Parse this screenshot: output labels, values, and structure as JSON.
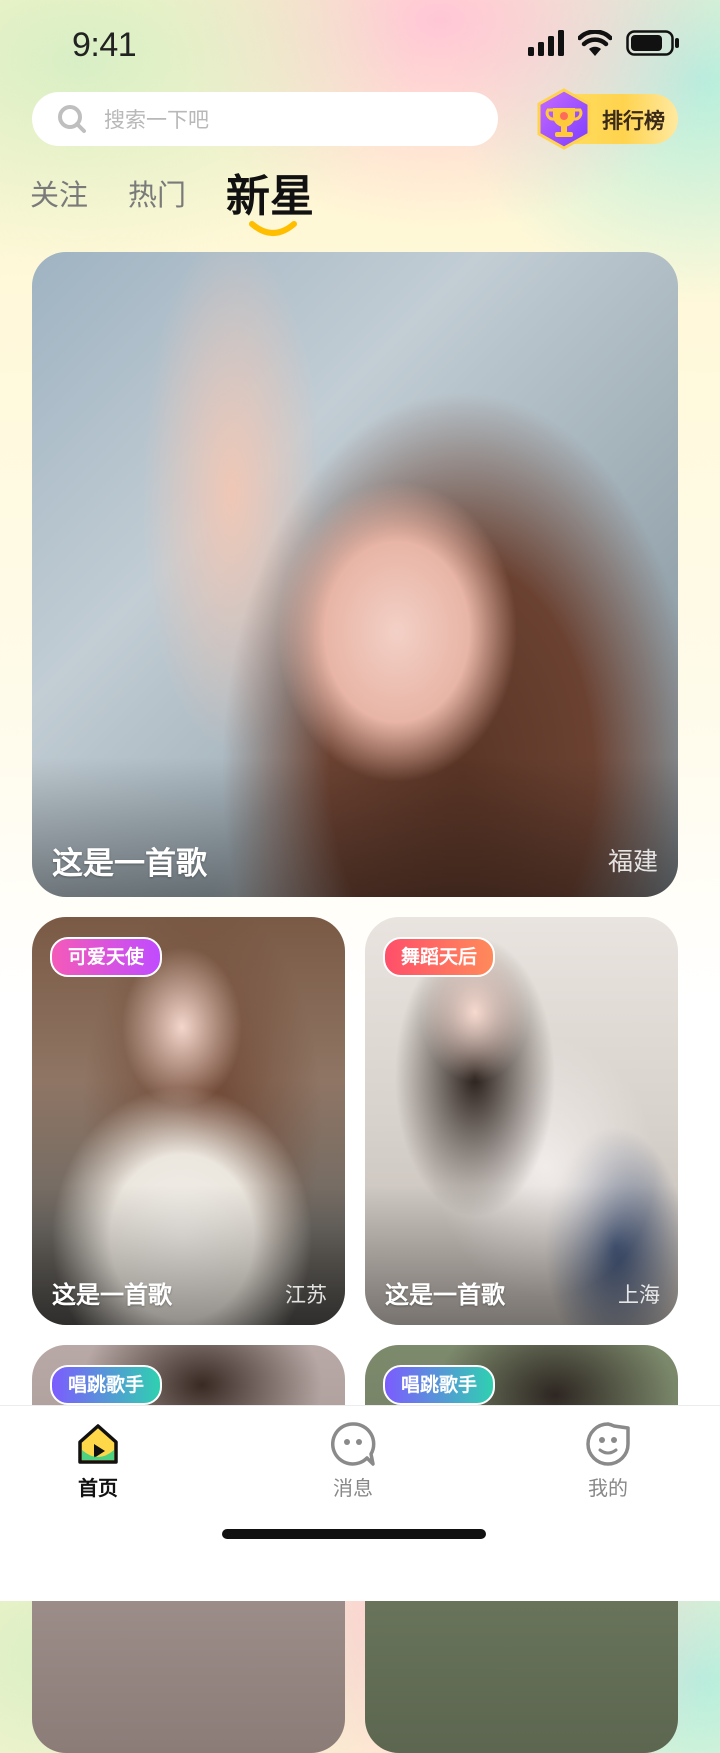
{
  "status_bar": {
    "time": "9:41",
    "icons": [
      "signal-icon",
      "wifi-icon",
      "battery-icon"
    ]
  },
  "search": {
    "placeholder": "搜索一下吧",
    "icon": "search-icon"
  },
  "ranking_button": {
    "label": "排行榜",
    "icon": "trophy-icon"
  },
  "tabs": [
    {
      "label": "关注",
      "active": false
    },
    {
      "label": "热门",
      "active": false
    },
    {
      "label": "新星",
      "active": true
    }
  ],
  "featured": {
    "title": "这是一首歌",
    "location": "福建"
  },
  "grid": [
    {
      "tag": "可爱天使",
      "title": "这是一首歌",
      "location": "江苏"
    },
    {
      "tag": "舞蹈天后",
      "title": "这是一首歌",
      "location": "上海"
    },
    {
      "tag": "唱跳歌手"
    },
    {
      "tag": "唱跳歌手"
    }
  ],
  "bottom_nav": [
    {
      "label": "首页",
      "icon": "home-icon",
      "active": true
    },
    {
      "label": "消息",
      "icon": "message-icon",
      "active": false
    },
    {
      "label": "我的",
      "icon": "profile-icon",
      "active": false
    }
  ],
  "colors": {
    "accent_yellow": "#FFD34D",
    "tag_pink": "#F04FB0",
    "tag_red": "#FF5A6A",
    "tag_purple": "#7C5CFF"
  }
}
